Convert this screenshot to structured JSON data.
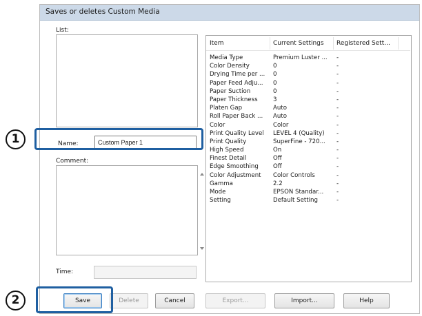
{
  "dialog": {
    "title": "Saves or deletes Custom Media",
    "list_label": "List:",
    "name_label": "Name:",
    "name_value": "Custom Paper 1",
    "comment_label": "Comment:",
    "time_label": "Time:"
  },
  "table": {
    "headers": [
      "Item",
      "Current Settings",
      "Registered Sett..."
    ],
    "rows": [
      [
        "Media Type",
        "Premium Luster ...",
        "-"
      ],
      [
        "Color Density",
        "0",
        "-"
      ],
      [
        "Drying Time per ...",
        "0",
        "-"
      ],
      [
        "Paper Feed Adju...",
        "0",
        "-"
      ],
      [
        "Paper Suction",
        "0",
        "-"
      ],
      [
        "Paper Thickness",
        "3",
        "-"
      ],
      [
        "Platen Gap",
        "Auto",
        "-"
      ],
      [
        "Roll Paper Back ...",
        "Auto",
        "-"
      ],
      [
        "Color",
        "Color",
        "-"
      ],
      [
        "Print Quality Level",
        "LEVEL 4 (Quality)",
        "-"
      ],
      [
        "Print Quality",
        "SuperFine - 720...",
        "-"
      ],
      [
        "High Speed",
        "On",
        "-"
      ],
      [
        "Finest Detail",
        "Off",
        "-"
      ],
      [
        "Edge Smoothing",
        "Off",
        "-"
      ],
      [
        "Color Adjustment",
        "Color Controls",
        "-"
      ],
      [
        "Gamma",
        "2.2",
        "-"
      ],
      [
        "Mode",
        "EPSON Standar...",
        "-"
      ],
      [
        "Setting",
        "Default Setting",
        "-"
      ]
    ]
  },
  "buttons": {
    "save": "Save",
    "delete": "Delete",
    "cancel": "Cancel",
    "export": "Export...",
    "import": "Import...",
    "help": "Help"
  },
  "markers": {
    "one": "1",
    "two": "2"
  },
  "colors": {
    "highlight": "#1f5fa1",
    "titlebar": "#ccd9e8"
  }
}
